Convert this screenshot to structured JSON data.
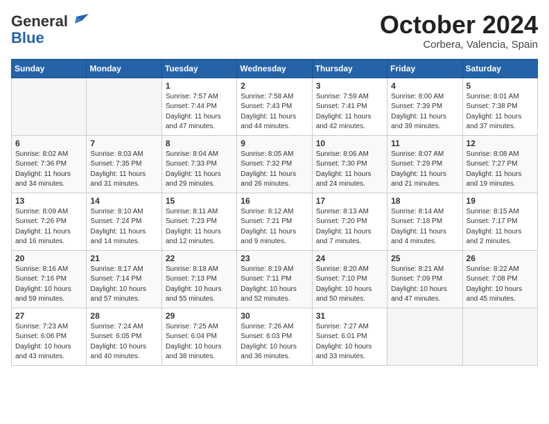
{
  "header": {
    "logo_line1": "General",
    "logo_line2": "Blue",
    "month": "October 2024",
    "location": "Corbera, Valencia, Spain"
  },
  "days_of_week": [
    "Sunday",
    "Monday",
    "Tuesday",
    "Wednesday",
    "Thursday",
    "Friday",
    "Saturday"
  ],
  "weeks": [
    [
      {
        "day": "",
        "info": ""
      },
      {
        "day": "",
        "info": ""
      },
      {
        "day": "1",
        "info": "Sunrise: 7:57 AM\nSunset: 7:44 PM\nDaylight: 11 hours and 47 minutes."
      },
      {
        "day": "2",
        "info": "Sunrise: 7:58 AM\nSunset: 7:43 PM\nDaylight: 11 hours and 44 minutes."
      },
      {
        "day": "3",
        "info": "Sunrise: 7:59 AM\nSunset: 7:41 PM\nDaylight: 11 hours and 42 minutes."
      },
      {
        "day": "4",
        "info": "Sunrise: 8:00 AM\nSunset: 7:39 PM\nDaylight: 11 hours and 39 minutes."
      },
      {
        "day": "5",
        "info": "Sunrise: 8:01 AM\nSunset: 7:38 PM\nDaylight: 11 hours and 37 minutes."
      }
    ],
    [
      {
        "day": "6",
        "info": "Sunrise: 8:02 AM\nSunset: 7:36 PM\nDaylight: 11 hours and 34 minutes."
      },
      {
        "day": "7",
        "info": "Sunrise: 8:03 AM\nSunset: 7:35 PM\nDaylight: 11 hours and 31 minutes."
      },
      {
        "day": "8",
        "info": "Sunrise: 8:04 AM\nSunset: 7:33 PM\nDaylight: 11 hours and 29 minutes."
      },
      {
        "day": "9",
        "info": "Sunrise: 8:05 AM\nSunset: 7:32 PM\nDaylight: 11 hours and 26 minutes."
      },
      {
        "day": "10",
        "info": "Sunrise: 8:06 AM\nSunset: 7:30 PM\nDaylight: 11 hours and 24 minutes."
      },
      {
        "day": "11",
        "info": "Sunrise: 8:07 AM\nSunset: 7:29 PM\nDaylight: 11 hours and 21 minutes."
      },
      {
        "day": "12",
        "info": "Sunrise: 8:08 AM\nSunset: 7:27 PM\nDaylight: 11 hours and 19 minutes."
      }
    ],
    [
      {
        "day": "13",
        "info": "Sunrise: 8:09 AM\nSunset: 7:26 PM\nDaylight: 11 hours and 16 minutes."
      },
      {
        "day": "14",
        "info": "Sunrise: 8:10 AM\nSunset: 7:24 PM\nDaylight: 11 hours and 14 minutes."
      },
      {
        "day": "15",
        "info": "Sunrise: 8:11 AM\nSunset: 7:23 PM\nDaylight: 11 hours and 12 minutes."
      },
      {
        "day": "16",
        "info": "Sunrise: 8:12 AM\nSunset: 7:21 PM\nDaylight: 11 hours and 9 minutes."
      },
      {
        "day": "17",
        "info": "Sunrise: 8:13 AM\nSunset: 7:20 PM\nDaylight: 11 hours and 7 minutes."
      },
      {
        "day": "18",
        "info": "Sunrise: 8:14 AM\nSunset: 7:18 PM\nDaylight: 11 hours and 4 minutes."
      },
      {
        "day": "19",
        "info": "Sunrise: 8:15 AM\nSunset: 7:17 PM\nDaylight: 11 hours and 2 minutes."
      }
    ],
    [
      {
        "day": "20",
        "info": "Sunrise: 8:16 AM\nSunset: 7:16 PM\nDaylight: 10 hours and 59 minutes."
      },
      {
        "day": "21",
        "info": "Sunrise: 8:17 AM\nSunset: 7:14 PM\nDaylight: 10 hours and 57 minutes."
      },
      {
        "day": "22",
        "info": "Sunrise: 8:18 AM\nSunset: 7:13 PM\nDaylight: 10 hours and 55 minutes."
      },
      {
        "day": "23",
        "info": "Sunrise: 8:19 AM\nSunset: 7:11 PM\nDaylight: 10 hours and 52 minutes."
      },
      {
        "day": "24",
        "info": "Sunrise: 8:20 AM\nSunset: 7:10 PM\nDaylight: 10 hours and 50 minutes."
      },
      {
        "day": "25",
        "info": "Sunrise: 8:21 AM\nSunset: 7:09 PM\nDaylight: 10 hours and 47 minutes."
      },
      {
        "day": "26",
        "info": "Sunrise: 8:22 AM\nSunset: 7:08 PM\nDaylight: 10 hours and 45 minutes."
      }
    ],
    [
      {
        "day": "27",
        "info": "Sunrise: 7:23 AM\nSunset: 6:06 PM\nDaylight: 10 hours and 43 minutes."
      },
      {
        "day": "28",
        "info": "Sunrise: 7:24 AM\nSunset: 6:05 PM\nDaylight: 10 hours and 40 minutes."
      },
      {
        "day": "29",
        "info": "Sunrise: 7:25 AM\nSunset: 6:04 PM\nDaylight: 10 hours and 38 minutes."
      },
      {
        "day": "30",
        "info": "Sunrise: 7:26 AM\nSunset: 6:03 PM\nDaylight: 10 hours and 36 minutes."
      },
      {
        "day": "31",
        "info": "Sunrise: 7:27 AM\nSunset: 6:01 PM\nDaylight: 10 hours and 33 minutes."
      },
      {
        "day": "",
        "info": ""
      },
      {
        "day": "",
        "info": ""
      }
    ]
  ]
}
